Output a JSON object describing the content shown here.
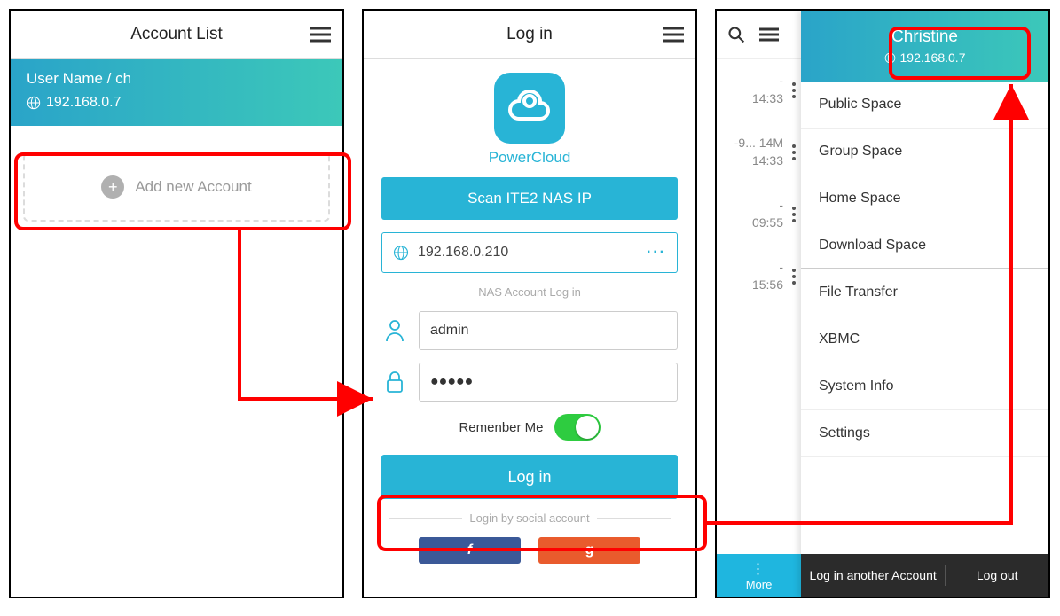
{
  "screen1": {
    "title": "Account List",
    "account": {
      "username": "User Name / ch",
      "ip": "192.168.0.7"
    },
    "add_label": "Add new Account"
  },
  "screen2": {
    "title": "Log in",
    "app_name": "PowerCloud",
    "scan_label": "Scan ITE2 NAS IP",
    "ip_value": "192.168.0.210",
    "section_label": "NAS Account Log in",
    "username_value": "admin",
    "password_value": "●●●●●",
    "remember_label": "Remenber Me",
    "login_label": "Log in",
    "social_label": "Login by social account"
  },
  "screen3": {
    "user": {
      "name": "Christine",
      "ip": "192.168.0.7"
    },
    "left_rows": [
      {
        "line1": "-",
        "line2": "14:33"
      },
      {
        "line1": "-9...  14M",
        "line2": "14:33"
      },
      {
        "line1": "-",
        "line2": "09:55"
      },
      {
        "line1": "-",
        "line2": "15:56"
      }
    ],
    "more_label": "More",
    "menu": [
      "Public Space",
      "Group Space",
      "Home Space",
      "Download Space",
      "File Transfer",
      "XBMC",
      "System Info",
      "Settings"
    ],
    "bottom": {
      "another": "Log in another Account",
      "logout": "Log out"
    }
  }
}
